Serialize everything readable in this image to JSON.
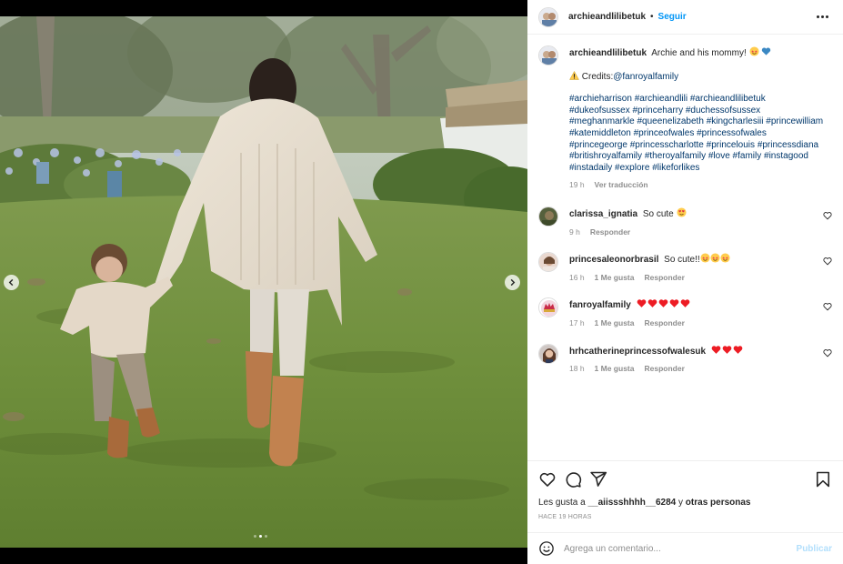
{
  "post": {
    "author": "archieandlilibetuk",
    "follow_label": "Seguir",
    "separator": "•",
    "caption_text": "Archie and his mommy!",
    "credits_text": "Credits:",
    "credits_handle": "@fanroyalfamily",
    "hashtags": [
      "#archieharrison",
      "#archieandlili",
      "#archieandlilibetuk",
      "#dukeofsussex",
      "#princeharry",
      "#duchessofsussex",
      "#meghanmarkle",
      "#queenelizabeth",
      "#kingcharlesiii",
      "#princewilliam",
      "#katemiddleton",
      "#princeofwales",
      "#princessofwales",
      "#princegeorge",
      "#princesscharlotte",
      "#princelouis",
      "#princessdiana",
      "#britishroyalfamily",
      "#theroyalfamily",
      "#love",
      "#family",
      "#instagood",
      "#instadaily",
      "#explore",
      "#likeforlikes"
    ],
    "caption_time": "19 h",
    "translate_label": "Ver traducción"
  },
  "comments": [
    {
      "user": "clarissa_ignatia",
      "text": "So cute",
      "time": "9 h",
      "likes": "",
      "reply": "Responder"
    },
    {
      "user": "princesaleonorbrasil",
      "text": "So cute!!",
      "time": "16 h",
      "likes": "1 Me gusta",
      "reply": "Responder"
    },
    {
      "user": "fanroyalfamily",
      "text": "",
      "time": "17 h",
      "likes": "1 Me gusta",
      "reply": "Responder"
    },
    {
      "user": "hrhcatherineprincessofwalesuk",
      "text": "",
      "time": "18 h",
      "likes": "1 Me gusta",
      "reply": "Responder"
    }
  ],
  "likes_line": {
    "prefix": "Les gusta a",
    "user": "__aiissshhhh__6284",
    "middle": "y",
    "suffix": "otras personas"
  },
  "time_ago": "HACE 19 HORAS",
  "add_comment": {
    "placeholder": "Agrega un comentario...",
    "publish_label": "Publicar"
  },
  "carousel": {
    "dots": 3,
    "active_index": 1
  },
  "colors": {
    "link": "#00376b",
    "follow": "#0095f6",
    "publish_disabled": "#b2dffc",
    "muted": "#8e8e8e",
    "heart_red": "#ed1c24"
  },
  "icons": [
    "chevron-left-icon",
    "chevron-right-icon",
    "more-icon",
    "heart-icon",
    "comment-icon",
    "share-icon",
    "bookmark-icon",
    "emoji-icon",
    "warning-icon"
  ]
}
